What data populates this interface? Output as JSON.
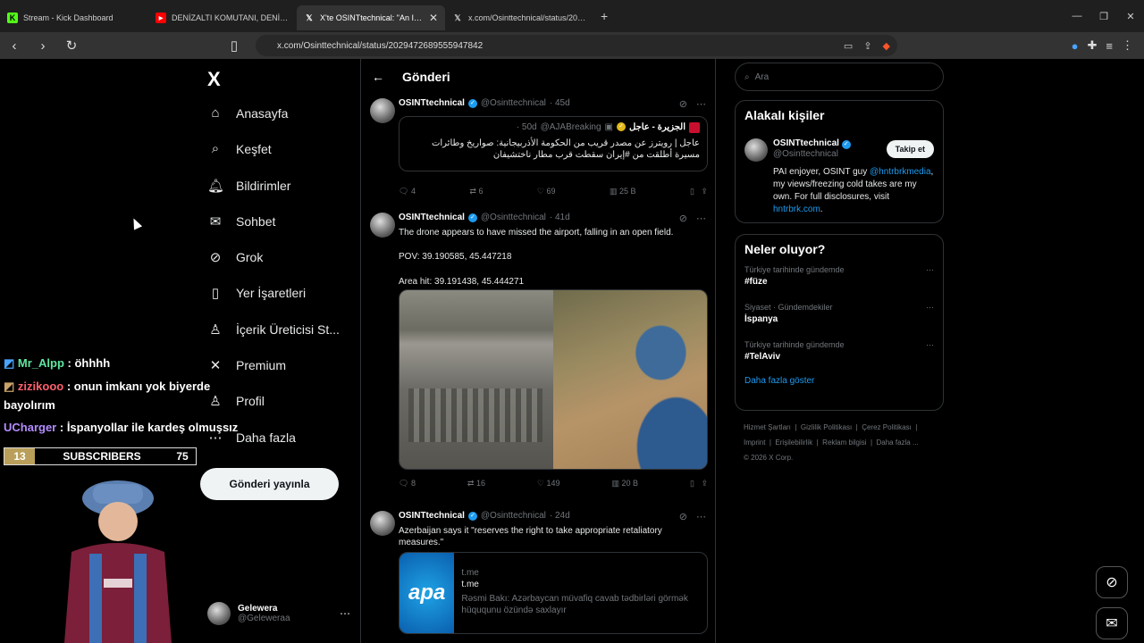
{
  "browser": {
    "tabs": [
      {
        "label": "Stream - Kick Dashboard",
        "icon": "kick-icon",
        "color": "#53fc18"
      },
      {
        "label": "DENİZALTI KOMUTANI, DENİZALTI SA",
        "icon": "youtube-icon",
        "color": "#ff0000"
      },
      {
        "label": "X'te OSINTtechnical: \"An Iran",
        "icon": "x-icon",
        "color": "#ffffff"
      },
      {
        "label": "x.com/Osinttechnical/status/2029472",
        "icon": "x-icon",
        "color": "#ffffff"
      }
    ],
    "url": "x.com/Osinttechnical/status/2029472689555947842"
  },
  "nav": {
    "logo": "X",
    "items": [
      {
        "label": "Anasayfa",
        "icon": "home-icon",
        "glyph": "⌂"
      },
      {
        "label": "Keşfet",
        "icon": "search-icon",
        "glyph": "⌕"
      },
      {
        "label": "Bildirimler",
        "icon": "bell-icon",
        "glyph": "🔔︎"
      },
      {
        "label": "Sohbet",
        "icon": "mail-icon",
        "glyph": "✉"
      },
      {
        "label": "Grok",
        "icon": "grok-icon",
        "glyph": "⊘"
      },
      {
        "label": "Yer İşaretleri",
        "icon": "bookmark-icon",
        "glyph": "▯"
      },
      {
        "label": "İçerik Üreticisi St...",
        "icon": "creator-icon",
        "glyph": "♙"
      },
      {
        "label": "Premium",
        "icon": "x-premium-icon",
        "glyph": "✕"
      },
      {
        "label": "Profil",
        "icon": "profile-icon",
        "glyph": "♙"
      },
      {
        "label": "Daha fazla",
        "icon": "more-icon",
        "glyph": "⋯"
      }
    ],
    "post_button": "Gönderi yayınla",
    "me": {
      "name": "Gelewera",
      "handle": "@Geleweraa"
    }
  },
  "column": {
    "title": "Gönderi",
    "tweets": [
      {
        "name": "OSINTtechnical",
        "handle": "@Osinttechnical",
        "time": "· 45d",
        "quote": {
          "name": "الجزيرة - عاجل",
          "handle": "@AJABreaking",
          "time": "· 50d",
          "text": "عاجل | رويترز عن مصدر قريب من الحكومة الأذربيجانية: صواريخ وطائرات مسيرة أطلقت من #إيران سقطت قرب مطار ناختشيفان"
        },
        "replies": "4",
        "reposts": "6",
        "likes": "69",
        "views": "25 B"
      },
      {
        "name": "OSINTtechnical",
        "handle": "@Osinttechnical",
        "time": "· 41d",
        "line1": "The drone appears to have missed the airport, falling in an open field.",
        "line2": "POV: 39.190585, 45.447218",
        "line3": "Area hit: 39.191438, 45.444271",
        "replies": "8",
        "reposts": "16",
        "likes": "149",
        "views": "20 B"
      },
      {
        "name": "OSINTtechnical",
        "handle": "@Osinttechnical",
        "time": "· 24d",
        "text": "Azerbaijan says it \"reserves the right to take appropriate retaliatory measures.\"",
        "card": {
          "logo": "apa",
          "domain": "t.me",
          "title": "t.me",
          "desc": "Rəsmi Bakı: Azərbaycan müvafiq cavab tədbirləri görmək hüququnu özündə saxlayır"
        }
      }
    ]
  },
  "right": {
    "search_placeholder": "Ara",
    "related_title": "Alakalı kişiler",
    "person": {
      "name": "OSINTtechnical",
      "handle": "@Osinttechnical",
      "follow": "Takip et",
      "bio_a": "PAI enjoyer, OSINT guy ",
      "bio_link": "@hntrbrkmedia",
      "bio_b": ", my views/freezing cold takes are my own. For full disclosures, visit ",
      "bio_url": "hntrbrk.com",
      "bio_end": "."
    },
    "happening_title": "Neler oluyor?",
    "trends": [
      {
        "context": "Türkiye tarihinde gündemde",
        "topic": "#füze"
      },
      {
        "context": "Siyaset · Gündemdekiler",
        "topic": "İspanya"
      },
      {
        "context": "Türkiye tarihinde gündemde",
        "topic": "#TelAviv"
      }
    ],
    "show_more": "Daha fazla göster",
    "footer": [
      "Hizmet Şartları",
      "Gizlilik Politikası",
      "Çerez Politikası",
      "Imprint",
      "Erişilebilirlik",
      "Reklam bilgisi",
      "Daha fazla ...",
      "© 2026 X Corp."
    ]
  },
  "stream": {
    "chat": [
      {
        "user": "Mr_Alpp",
        "msg": ": öhhhh",
        "color": "#5ee6a0"
      },
      {
        "user": "zizikooo",
        "msg": ": onun imkanı yok biyerde",
        "cont": "bayolırım",
        "color": "#ff5f6d"
      },
      {
        "user": "UCharger",
        "msg": ": İspanyollar ile kardeş olmuşsız",
        "color": "#b48cff"
      }
    ],
    "subs": {
      "left": "13",
      "label": "SUBSCRIBERS",
      "right": "75"
    }
  }
}
